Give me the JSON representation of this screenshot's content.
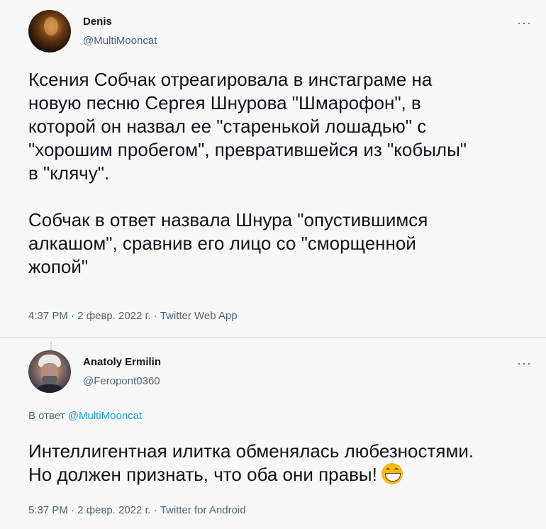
{
  "tweets": [
    {
      "author_name": "Denis",
      "author_handle": "@MultiMooncat",
      "more": "···",
      "text": "Ксения Собчак отреагировала в инстаграме на\nновую песню Сергея Шнурова \"Шмарофон\", в\nкоторой он назвал ее \"старенькой лошадью\" с\n\"хорошим пробегом\", превратившейся из \"кобылы\"\nв \"клячу\".\n\nСобчак в ответ назвала Шнура \"опустившимся\nалкашом\", сравнив его лицо со \"сморщенной\nжопой\"",
      "meta": "4:37 PM · 2 февр. 2022 г. · Twitter Web App"
    },
    {
      "author_name": "Anatoly Ermilin",
      "author_handle": "@Feropont0360",
      "more": "···",
      "reply_prefix": "В ответ",
      "reply_handle": "@MultiMooncat",
      "text": "Интеллигентная илитка обменялась любезностями.\nНо должен признать, что оба они правы!",
      "emoji": "grinning-face-emoji",
      "meta": "5:37 PM · 2 февр. 2022 г. · Twitter for Android"
    }
  ],
  "colors": {
    "background": "#f7f9f9",
    "text": "#0f1419",
    "secondary": "#536471",
    "link": "#1d9bf0"
  }
}
